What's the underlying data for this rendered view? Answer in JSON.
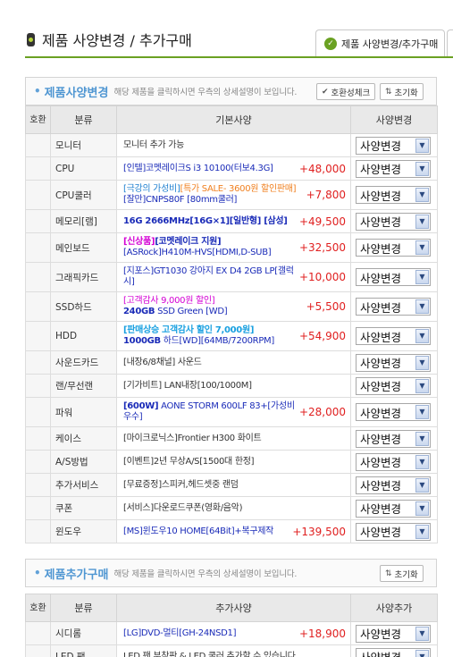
{
  "page": {
    "title": "제품 사양변경 / 추가구매",
    "tab_label": "제품 사양변경/추가구매"
  },
  "section1": {
    "title": "제품사양변경",
    "desc": "해당 제품을 클릭하시면 우측의 상세설명이 보입니다.",
    "compat_btn": "호환성체크",
    "reset_btn": "초기화",
    "headers": {
      "ex": "호환",
      "cat": "분류",
      "spec": "기본사양",
      "change": "사양변경"
    },
    "select_value": "사양변경",
    "rows": [
      {
        "cat": "모니터",
        "parts": [
          {
            "t": "모니터 추가 가능",
            "s": "dark"
          }
        ],
        "price": ""
      },
      {
        "cat": "CPU",
        "parts": [
          {
            "t": "[인텔]코멧레이크S i3 10100(터보4.3G]",
            "s": "blue"
          }
        ],
        "price": "+48,000"
      },
      {
        "cat": "CPU쿨러",
        "parts": [
          {
            "t": "[극강의 가성비]",
            "s": "sky"
          },
          {
            "t": "[특가 SALE- 3600원 할인판매]",
            "s": "orange"
          },
          {
            "t": "[잘만]CNPS80F [80mm쿨러]",
            "s": "blue",
            "br": true
          }
        ],
        "price": "+7,800"
      },
      {
        "cat": "메모리[램]",
        "parts": [
          {
            "t": "16G 2666MHz[16G×1][일반형] [삼성]",
            "s": "navy"
          }
        ],
        "price": "+49,500"
      },
      {
        "cat": "메인보드",
        "parts": [
          {
            "t": "[신상품]",
            "s": "magbold"
          },
          {
            "t": "[코멧레이크 지원]",
            "s": "navy"
          },
          {
            "t": "[ASRock]H410M-HVS[HDMI,D-SUB]",
            "s": "blue",
            "br": true
          }
        ],
        "price": "+32,500"
      },
      {
        "cat": "그래픽카드",
        "parts": [
          {
            "t": "[지포스]GT1030 강아지 EX D4 2GB LP[갤럭시]",
            "s": "blue"
          }
        ],
        "price": "+10,000"
      },
      {
        "cat": "SSD하드",
        "parts": [
          {
            "t": "[고객감사 9,000원 할인]",
            "s": "pink"
          },
          {
            "t": "240GB",
            "s": "navy",
            "br": true
          },
          {
            "t": " SSD Green [WD]",
            "s": "blue"
          }
        ],
        "price": "+5,500"
      },
      {
        "cat": "HDD",
        "parts": [
          {
            "t": "[판매상승 고객감사 할인 7,000원]",
            "s": "cyanbold"
          },
          {
            "t": "1000GB",
            "s": "navy",
            "br": true
          },
          {
            "t": " 하드[WD][64MB/7200RPM]",
            "s": "blue"
          }
        ],
        "price": "+54,900"
      },
      {
        "cat": "사운드카드",
        "parts": [
          {
            "t": "[내장6/8채널] 사운드",
            "s": "dark"
          }
        ],
        "price": ""
      },
      {
        "cat": "랜/무선랜",
        "parts": [
          {
            "t": "[기가비트] LAN내장[100/1000M]",
            "s": "dark"
          }
        ],
        "price": ""
      },
      {
        "cat": "파워",
        "parts": [
          {
            "t": "[600W]",
            "s": "navy"
          },
          {
            "t": " AONE STORM 600LF 83+[가성비우수]",
            "s": "blue"
          }
        ],
        "price": "+28,000"
      },
      {
        "cat": "케이스",
        "parts": [
          {
            "t": "[마이크로닉스]Frontier H300 화이트",
            "s": "dark"
          }
        ],
        "price": ""
      },
      {
        "cat": "A/S방법",
        "parts": [
          {
            "t": "[이벤트]2년 무상A/S[1500대 한정]",
            "s": "dark"
          }
        ],
        "price": ""
      },
      {
        "cat": "추가서비스",
        "parts": [
          {
            "t": "[무료증정]스피커,헤드셋중 랜덤",
            "s": "dark"
          }
        ],
        "price": ""
      },
      {
        "cat": "쿠폰",
        "parts": [
          {
            "t": "[서비스]다운로드쿠폰(영화/음악)",
            "s": "dark"
          }
        ],
        "price": ""
      },
      {
        "cat": "윈도우",
        "parts": [
          {
            "t": "[MS]윈도우10 HOME[64Bit]+복구제작",
            "s": "blue"
          }
        ],
        "price": "+139,500"
      }
    ]
  },
  "section2": {
    "title": "제품추가구매",
    "desc": "해당 제품을 클릭하시면 우측의 상세설명이 보입니다.",
    "reset_btn": "초기화",
    "headers": {
      "ex": "호환",
      "cat": "분류",
      "spec": "추가사양",
      "change": "사양추가"
    },
    "select_value": "사양변경",
    "rows": [
      {
        "cat": "시디롬",
        "parts": [
          {
            "t": "[LG]DVD-멀티[GH-24NSD1]",
            "s": "blue"
          }
        ],
        "price": "+18,900"
      },
      {
        "cat": "LED 팬",
        "parts": [
          {
            "t": "LED 팬 부착판 & LED 쿨러 추가할 수 있습니다",
            "s": "dark"
          }
        ],
        "price": ""
      }
    ]
  }
}
